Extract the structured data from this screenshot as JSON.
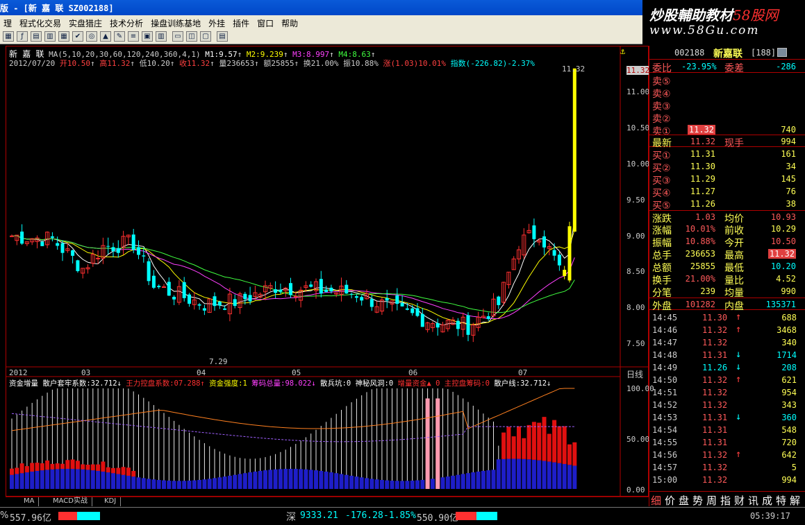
{
  "window": {
    "title": "版 - [新 嘉 联 SZ002188]"
  },
  "banner": {
    "line1_a": "炒股輔助教材",
    "line1_b": "58股网",
    "line2": "www.58Gu.com"
  },
  "menu": [
    "理",
    "程式化交易",
    "实盘猎庄",
    "技术分析",
    "操盘训练基地",
    "外挂",
    "插件",
    "窗口",
    "帮助"
  ],
  "chart_info": {
    "name": "新 嘉 联",
    "ma": "MA(5,10,20,30,60,120,240,360,4,1)",
    "m1": "M1:9.57",
    "m2": "M2:9.239",
    "m3": "M3:8.997",
    "m4": "M4:8.63",
    "date": "2012/07/20",
    "open": "开10.50",
    "high": "高11.32",
    "low": "低10.20",
    "close": "收11.32",
    "vol": "量236653",
    "amt": "额25855",
    "turn": "换21.00%",
    "amp": "振10.88%",
    "chg": "涨(1.03)10.01%",
    "idx": "指数(-226.82)-2.37%"
  },
  "annotations": {
    "high": "11.32",
    "low": "7.29",
    "last_price_tag": "11.32"
  },
  "y_axis_labels": [
    "11.00",
    "10.50",
    "10.00",
    "9.50",
    "9.00",
    "8.50",
    "8.00",
    "7.50"
  ],
  "x_axis_labels": [
    "2012",
    "03",
    "04",
    "05",
    "06",
    "07"
  ],
  "period_label": "日线",
  "indicator": {
    "i1": "资金增量",
    "i2": "散户套牢系数:32.712↓",
    "i3": "王力控盘系数:07.288↑",
    "i4": "资金强度:1",
    "i5": "筹码总量:98.022↓",
    "i6": "散兵坑:0",
    "i7": "神秘风洞:0",
    "i8": "增量资金▲ 0",
    "i9": "主控盘筹码:0",
    "i10": "散户线:32.712↓",
    "y_labels": [
      "100.00",
      "50.00",
      "0.00"
    ]
  },
  "bottom_tabs": [
    "MA",
    "MACD实战",
    "KDJ"
  ],
  "quote": {
    "code": "002188",
    "name": "新嘉联",
    "code_num": "[188]",
    "weibi_label": "委比",
    "weibi": "-23.95%",
    "weicha_label": "委差",
    "weicha": "-286",
    "sells": [
      {
        "label": "卖⑤",
        "price": "",
        "vol": ""
      },
      {
        "label": "卖④",
        "price": "",
        "vol": ""
      },
      {
        "label": "卖③",
        "price": "",
        "vol": ""
      },
      {
        "label": "卖②",
        "price": "",
        "vol": ""
      },
      {
        "label": "卖①",
        "price": "11.32",
        "vol": "740"
      }
    ],
    "latest_label": "最新",
    "latest": "11.32",
    "nowhand_label": "现手",
    "nowhand": "994",
    "buys": [
      {
        "label": "买①",
        "price": "11.31",
        "vol": "161"
      },
      {
        "label": "买②",
        "price": "11.30",
        "vol": "34"
      },
      {
        "label": "买③",
        "price": "11.29",
        "vol": "145"
      },
      {
        "label": "买④",
        "price": "11.27",
        "vol": "76"
      },
      {
        "label": "买⑤",
        "price": "11.26",
        "vol": "38"
      }
    ],
    "stats": [
      {
        "l1": "涨跌",
        "v1": "1.03",
        "l2": "均价",
        "v2": "10.93"
      },
      {
        "l1": "涨幅",
        "v1": "10.01%",
        "l2": "前收",
        "v2": "10.29"
      },
      {
        "l1": "振幅",
        "v1": "10.88%",
        "l2": "今开",
        "v2": "10.50"
      },
      {
        "l1": "总手",
        "v1": "236653",
        "l2": "最高",
        "v2": "11.32"
      },
      {
        "l1": "总额",
        "v1": "25855",
        "l2": "最低",
        "v2": "10.20"
      },
      {
        "l1": "换手",
        "v1": "21.00%",
        "l2": "量比",
        "v2": "4.52"
      },
      {
        "l1": "分笔",
        "v1": "239",
        "l2": "均量",
        "v2": "990"
      }
    ],
    "outer_label": "外盘",
    "outer": "101282",
    "inner_label": "内盘",
    "inner": "135371",
    "ticks": [
      {
        "t": "14:45",
        "p": "11.30",
        "a": "↑",
        "v": "688"
      },
      {
        "t": "14:46",
        "p": "11.32",
        "a": "↑",
        "v": "3468"
      },
      {
        "t": "14:47",
        "p": "11.32",
        "a": "",
        "v": "340"
      },
      {
        "t": "14:48",
        "p": "11.31",
        "a": "↓",
        "v": "1714"
      },
      {
        "t": "14:49",
        "p": "11.26",
        "a": "↓",
        "v": "208"
      },
      {
        "t": "14:50",
        "p": "11.32",
        "a": "↑",
        "v": "621"
      },
      {
        "t": "14:51",
        "p": "11.32",
        "a": "",
        "v": "954"
      },
      {
        "t": "14:52",
        "p": "11.32",
        "a": "",
        "v": "343"
      },
      {
        "t": "14:53",
        "p": "11.31",
        "a": "↓",
        "v": "360"
      },
      {
        "t": "14:54",
        "p": "11.31",
        "a": "",
        "v": "548"
      },
      {
        "t": "14:55",
        "p": "11.31",
        "a": "",
        "v": "720"
      },
      {
        "t": "14:56",
        "p": "11.32",
        "a": "↑",
        "v": "642"
      },
      {
        "t": "14:57",
        "p": "11.32",
        "a": "",
        "v": "5"
      },
      {
        "t": "15:00",
        "p": "11.32",
        "a": "",
        "v": "994"
      }
    ],
    "tabs": [
      "细",
      "价",
      "盘",
      "势",
      "周",
      "指",
      "财",
      "讯",
      "成",
      "特",
      "解"
    ]
  },
  "status": {
    "left_pct": "%",
    "left_amt": "557.96亿",
    "idx_name": "深",
    "idx_val": "9333.21",
    "idx_chg": "-176.28",
    "idx_pct": "-1.85%",
    "idx_amt": "550.90亿",
    "time": "05:39:17"
  },
  "colors": {
    "bull": "#ff3030",
    "bear": "#00ffff",
    "yellow": "#ffff00",
    "ma_white": "#ffffff",
    "ma_yellow": "#ffff00",
    "ma_magenta": "#ff40ff",
    "ma_green": "#40ff40"
  }
}
